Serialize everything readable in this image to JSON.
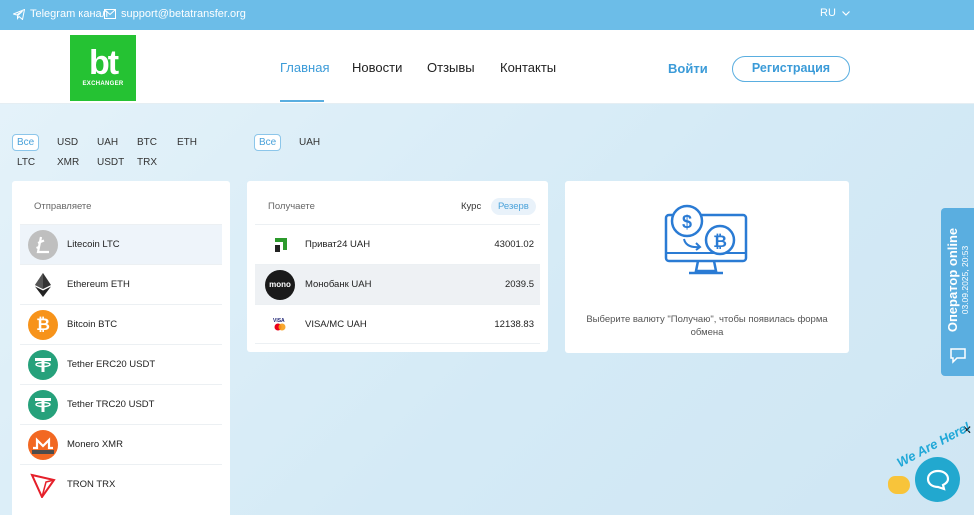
{
  "topbar": {
    "telegram_label": "Telegram канал",
    "email": "support@betatransfer.org",
    "language": "RU"
  },
  "header": {
    "logo_text": "bt",
    "logo_sub": "EXCHANGER",
    "nav": [
      "Главная",
      "Новости",
      "Отзывы",
      "Контакты"
    ],
    "login_label": "Войти",
    "register_label": "Регистрация"
  },
  "filters": {
    "send": [
      "Все",
      "USD",
      "UAH",
      "BTC",
      "ETH",
      "LTC",
      "XMR",
      "USDT",
      "TRX"
    ],
    "receive": [
      "Все",
      "UAH"
    ]
  },
  "send_panel": {
    "heading": "Отправляете",
    "items": [
      {
        "label": "Litecoin LTC",
        "icon": "litecoin-icon",
        "color": "#bfbfbf"
      },
      {
        "label": "Ethereum ETH",
        "icon": "ethereum-icon",
        "color": "#ffffff"
      },
      {
        "label": "Bitcoin BTC",
        "icon": "bitcoin-icon",
        "color": "#f7931a"
      },
      {
        "label": "Tether ERC20 USDT",
        "icon": "tether-icon",
        "color": "#26a17b"
      },
      {
        "label": "Tether TRC20 USDT",
        "icon": "tether-icon",
        "color": "#26a17b"
      },
      {
        "label": "Monero XMR",
        "icon": "monero-icon",
        "color": "#f26822"
      },
      {
        "label": "TRON TRX",
        "icon": "tron-icon",
        "color": "#e5202a"
      }
    ]
  },
  "receive_panel": {
    "heading": "Получаете",
    "tab_rate": "Курс",
    "tab_reserve": "Резерв",
    "items": [
      {
        "label": "Приват24 UAH",
        "value": "43001.02",
        "icon": "privat24-icon"
      },
      {
        "label": "Монобанк UAH",
        "value": "2039.5",
        "icon": "monobank-icon"
      },
      {
        "label": "VISA/MC UAH",
        "value": "12138.83",
        "icon": "visa-mastercard-icon"
      }
    ]
  },
  "exchange_hint": "Выберите валюту \"Получаю\", чтобы появилась форма обмена",
  "operator": {
    "title": "Оператор online",
    "datetime": "03.09.2025, 20:53"
  },
  "chat_widget": {
    "text": "We Are Here!"
  },
  "colors": {
    "topbar": "#6cbde8",
    "accent": "#3b9bd8",
    "logo": "#25c233"
  }
}
